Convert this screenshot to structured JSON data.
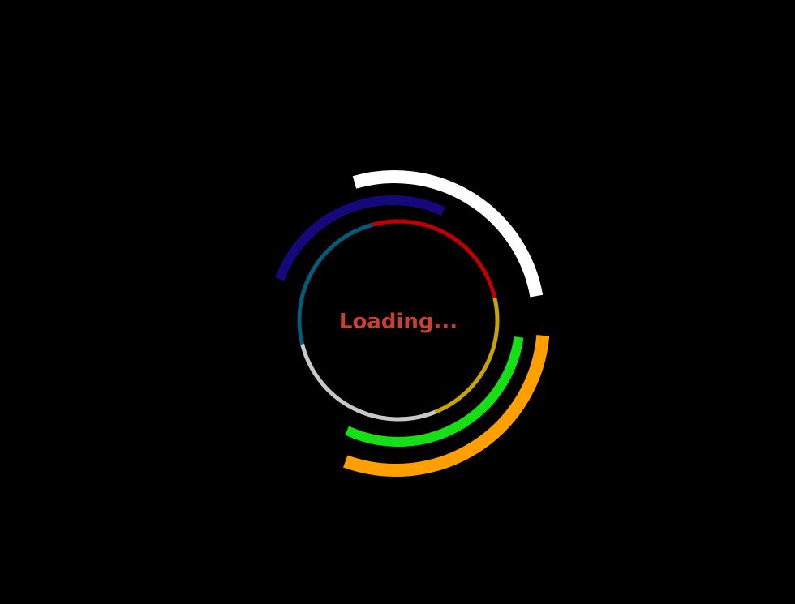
{
  "loader": {
    "label": "Loading...",
    "label_color": "#C9412F",
    "background": "#000000",
    "rings": [
      {
        "name": "ring-white-arc",
        "color": "#FFFFFF",
        "arcs": [
          {
            "start": 254,
            "end": 350
          }
        ]
      },
      {
        "name": "ring-navy-arc",
        "color": "#15087A",
        "arcs": [
          {
            "start": 200,
            "end": 295
          }
        ]
      },
      {
        "name": "ring-inner-circle",
        "color": "#C8C8C8",
        "arcs": [
          {
            "start": 255,
            "end": 347,
            "color": "#C00000"
          },
          {
            "start": 347,
            "end": 68,
            "color": "#C9A400"
          },
          {
            "start": 68,
            "end": 166,
            "color": "#C8C8C8"
          },
          {
            "start": 166,
            "end": 255,
            "color": "#055C7A"
          }
        ]
      },
      {
        "name": "ring-green-arc",
        "color": "#15E015",
        "arcs": [
          {
            "start": 8,
            "end": 115
          }
        ]
      },
      {
        "name": "ring-orange-arc",
        "color": "#FF9F00",
        "arcs": [
          {
            "start": 5,
            "end": 110
          }
        ]
      }
    ]
  }
}
